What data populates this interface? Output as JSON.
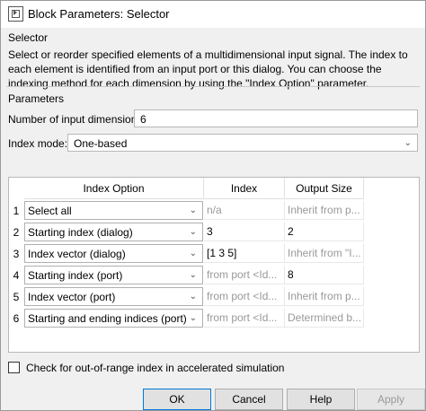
{
  "window": {
    "title": "Block Parameters: Selector"
  },
  "block": {
    "name": "Selector",
    "description": "Select or reorder specified elements of a multidimensional input signal. The index to each element is identified from an input port or this dialog. You can choose the indexing method for each dimension by using the \"Index Option\" parameter."
  },
  "parameters": {
    "label": "Parameters",
    "num_dims_label": "Number of input dimensions:",
    "num_dims_value": "6",
    "index_mode_label": "Index mode:",
    "index_mode_value": "One-based"
  },
  "table": {
    "headers": [
      "Index Option",
      "Index",
      "Output Size"
    ],
    "rows": [
      {
        "num": "1",
        "option": "Select all",
        "index": "n/a",
        "output": "Inherit from p...",
        "index_enabled": false,
        "output_enabled": false
      },
      {
        "num": "2",
        "option": "Starting index (dialog)",
        "index": "3",
        "output": "2",
        "index_enabled": true,
        "output_enabled": true
      },
      {
        "num": "3",
        "option": "Index vector (dialog)",
        "index": "[1 3 5]",
        "output": "Inherit from \"I...",
        "index_enabled": true,
        "output_enabled": false
      },
      {
        "num": "4",
        "option": "Starting index (port)",
        "index": "from port <Id...",
        "output": "8",
        "index_enabled": false,
        "output_enabled": true
      },
      {
        "num": "5",
        "option": "Index vector (port)",
        "index": "from port <Id...",
        "output": "Inherit from p...",
        "index_enabled": false,
        "output_enabled": false
      },
      {
        "num": "6",
        "option": "Starting and ending indices (port)",
        "index": "from port <Id...",
        "output": "Determined b...",
        "index_enabled": false,
        "output_enabled": false
      }
    ]
  },
  "checkbox": {
    "label": "Check for out-of-range index in accelerated simulation",
    "checked": false
  },
  "buttons": {
    "ok": "OK",
    "cancel": "Cancel",
    "help": "Help",
    "apply": "Apply"
  }
}
